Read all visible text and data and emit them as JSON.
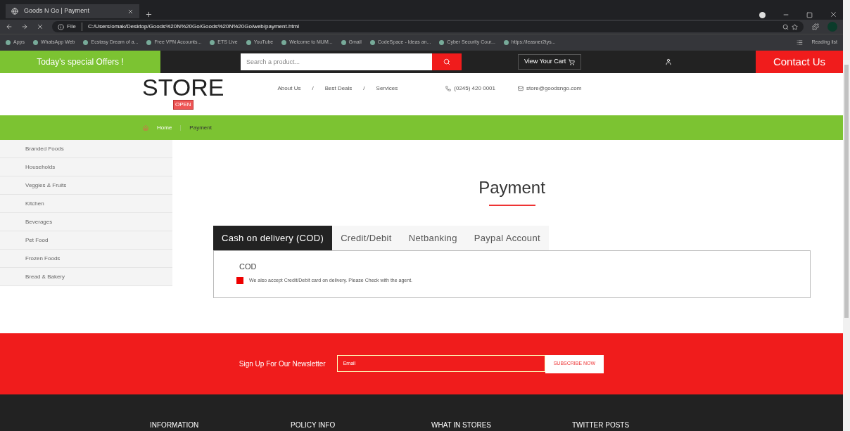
{
  "browser": {
    "tab_title": "Goods N Go | Payment",
    "address_scheme": "File",
    "address": "C:/Users/omak/Desktop/Goods%20N%20Go/Goods%20N%20Go/web/payment.html",
    "bookmarks": [
      "Apps",
      "WhatsApp Web",
      "Ecstasy Dream of a...",
      "Free VPN Accounts...",
      "ETS Live",
      "YouTube",
      "Welcome to MUM...",
      "Gmail",
      "CodeSpace - Ideas an...",
      "Cyber Security Cour...",
      "https://leasner2tys..."
    ],
    "reading_list": "Reading list"
  },
  "topbar": {
    "offers": "Today's special Offers !",
    "search": {
      "placeholder": "Search a product..."
    },
    "cart": "View Your Cart",
    "contact": "Contact Us"
  },
  "header": {
    "logo": "STORE",
    "logo_badge": "OPEN",
    "nav": [
      "About Us",
      "Best Deals",
      "Services"
    ],
    "separator": "/",
    "phone": "(0245) 420 0001",
    "email": "store@goodsngo.com"
  },
  "breadcrumb": [
    "Home",
    "Payment"
  ],
  "sidebar": {
    "items": [
      {
        "label": "Branded Foods"
      },
      {
        "label": "Households"
      },
      {
        "label": "Veggies & Fruits"
      },
      {
        "label": "Kitchen"
      },
      {
        "label": "Beverages"
      },
      {
        "label": "Pet Food"
      },
      {
        "label": "Frozen Foods"
      },
      {
        "label": "Bread & Bakery"
      }
    ]
  },
  "page_title": "Payment",
  "tabs": [
    {
      "label": "Cash on delivery (COD)",
      "selected": true
    },
    {
      "label": "Credit/Debit",
      "selected": false
    },
    {
      "label": "Netbanking",
      "selected": false
    },
    {
      "label": "Paypal Account",
      "selected": false
    }
  ],
  "panel": {
    "heading": "COD",
    "checked": true,
    "note": "We also accept Credit/Debit card on delivery. Please Check with the agent."
  },
  "newsletter": {
    "label": "Sign Up For Our Newsletter",
    "email": {
      "placeholder": "Email"
    },
    "button": "SUBSCRIBE NOW"
  },
  "footer": {
    "columns": [
      "INFORMATION",
      "POLICY INFO",
      "WHAT IN STORES",
      "TWITTER POSTS"
    ]
  }
}
